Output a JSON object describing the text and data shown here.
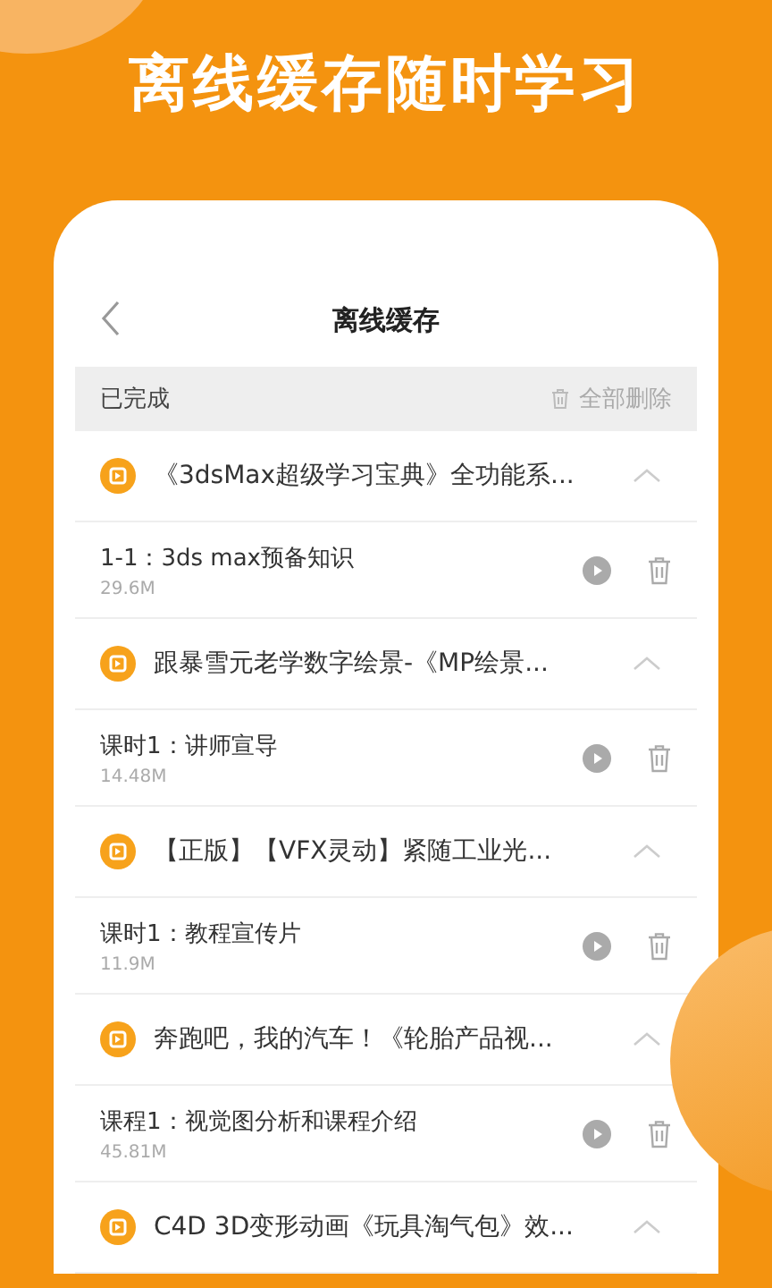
{
  "headline": "离线缓存随时学习",
  "screen": {
    "title": "离线缓存",
    "section": {
      "label": "已完成",
      "action": "全部删除"
    }
  },
  "groups": [
    {
      "title": "《3dsMax超级学习宝典》全功能系...",
      "expanded": true,
      "lessons": [
        {
          "title": "1-1：3ds max预备知识",
          "size": "29.6M"
        }
      ]
    },
    {
      "title": "跟暴雪元老学数字绘景-《MP绘景...",
      "expanded": true,
      "lessons": [
        {
          "title": "课时1：讲师宣导",
          "size": "14.48M"
        }
      ]
    },
    {
      "title": "【正版】【VFX灵动】紧随工业光...",
      "expanded": true,
      "lessons": [
        {
          "title": "课时1：教程宣传片",
          "size": "11.9M"
        }
      ]
    },
    {
      "title": "奔跑吧，我的汽车！《轮胎产品视...",
      "expanded": true,
      "lessons": [
        {
          "title": "课程1：视觉图分析和课程介绍",
          "size": "45.81M"
        }
      ]
    },
    {
      "title": "C4D 3D变形动画《玩具淘气包》效...",
      "expanded": true
    }
  ]
}
